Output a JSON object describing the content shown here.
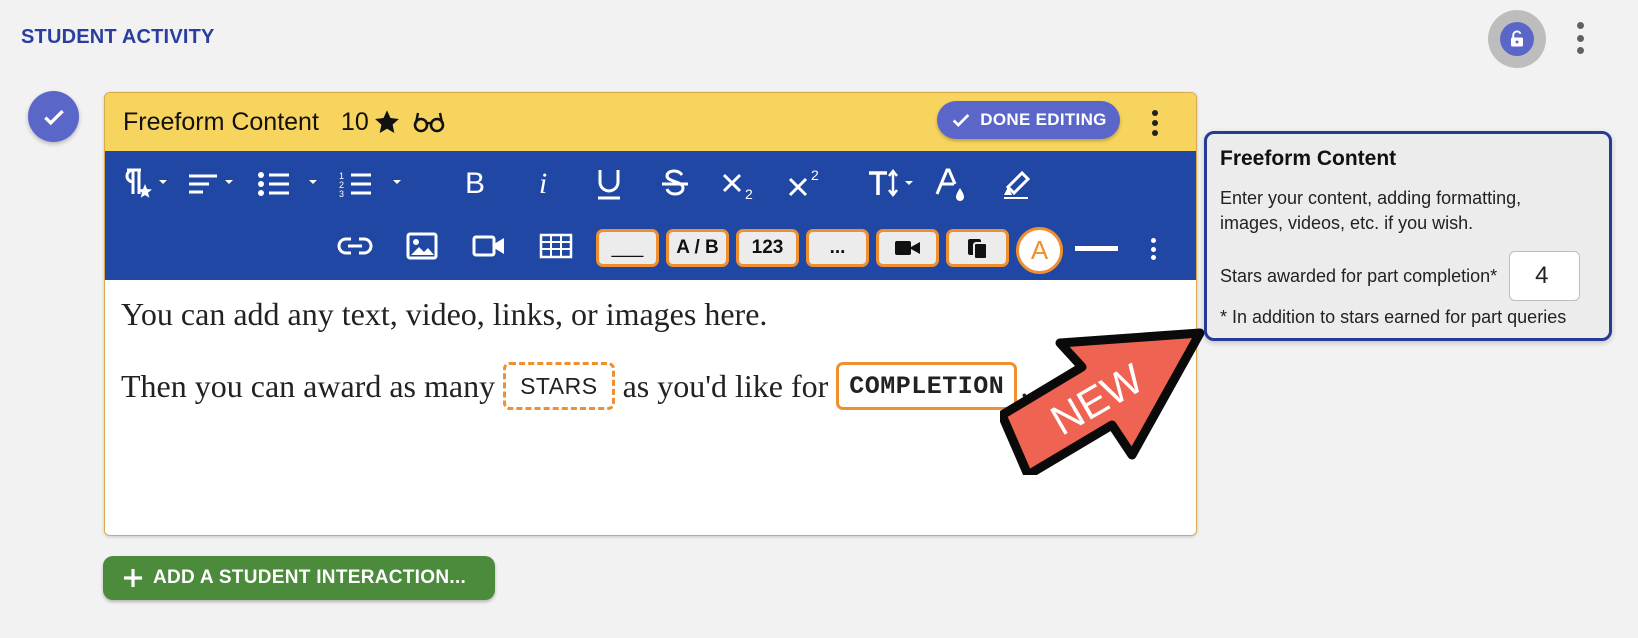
{
  "page": {
    "title": "STUDENT ACTIVITY"
  },
  "card": {
    "title": "Freeform Content",
    "stars": "10",
    "done_label": "DONE EDITING"
  },
  "toolbar": {
    "row1_icons": [
      "paragraph-style-icon",
      "align-icon",
      "bullet-list-icon",
      "numbered-list-icon",
      "bold-icon",
      "italic-icon",
      "underline-icon",
      "strikethrough-icon",
      "subscript-icon",
      "superscript-icon",
      "font-size-icon",
      "text-color-icon",
      "highlight-icon"
    ],
    "row2_icons": [
      "link-icon",
      "image-icon",
      "video-icon",
      "table-icon"
    ],
    "chips": {
      "blank": "___",
      "choice": "A / B",
      "number": "123",
      "ellipsis": "...",
      "answer_letter": "A"
    }
  },
  "content": {
    "line1": "You can add any text, video, links, or images here.",
    "line2_a": "Then you can award as many",
    "stars_tag": "STARS",
    "line2_b": "as you'd like for",
    "completion_tag": "COMPLETION",
    "line2_c": "."
  },
  "badge": {
    "text": "NEW",
    "color": "#ee6352"
  },
  "popover": {
    "title": "Freeform Content",
    "description": "Enter your content, adding formatting, images, videos, etc. if you wish.",
    "stars_label": "Stars awarded for part completion*",
    "stars_value": "4",
    "note": "* In addition to stars earned for part queries"
  },
  "add_interaction": {
    "label": "ADD A STUDENT INTERACTION..."
  },
  "colors": {
    "accent": "#5b66c9",
    "toolbar": "#1f47a3",
    "header": "#f7d45d",
    "chip_border": "#ef8f2f",
    "add": "#4b8b3b"
  }
}
